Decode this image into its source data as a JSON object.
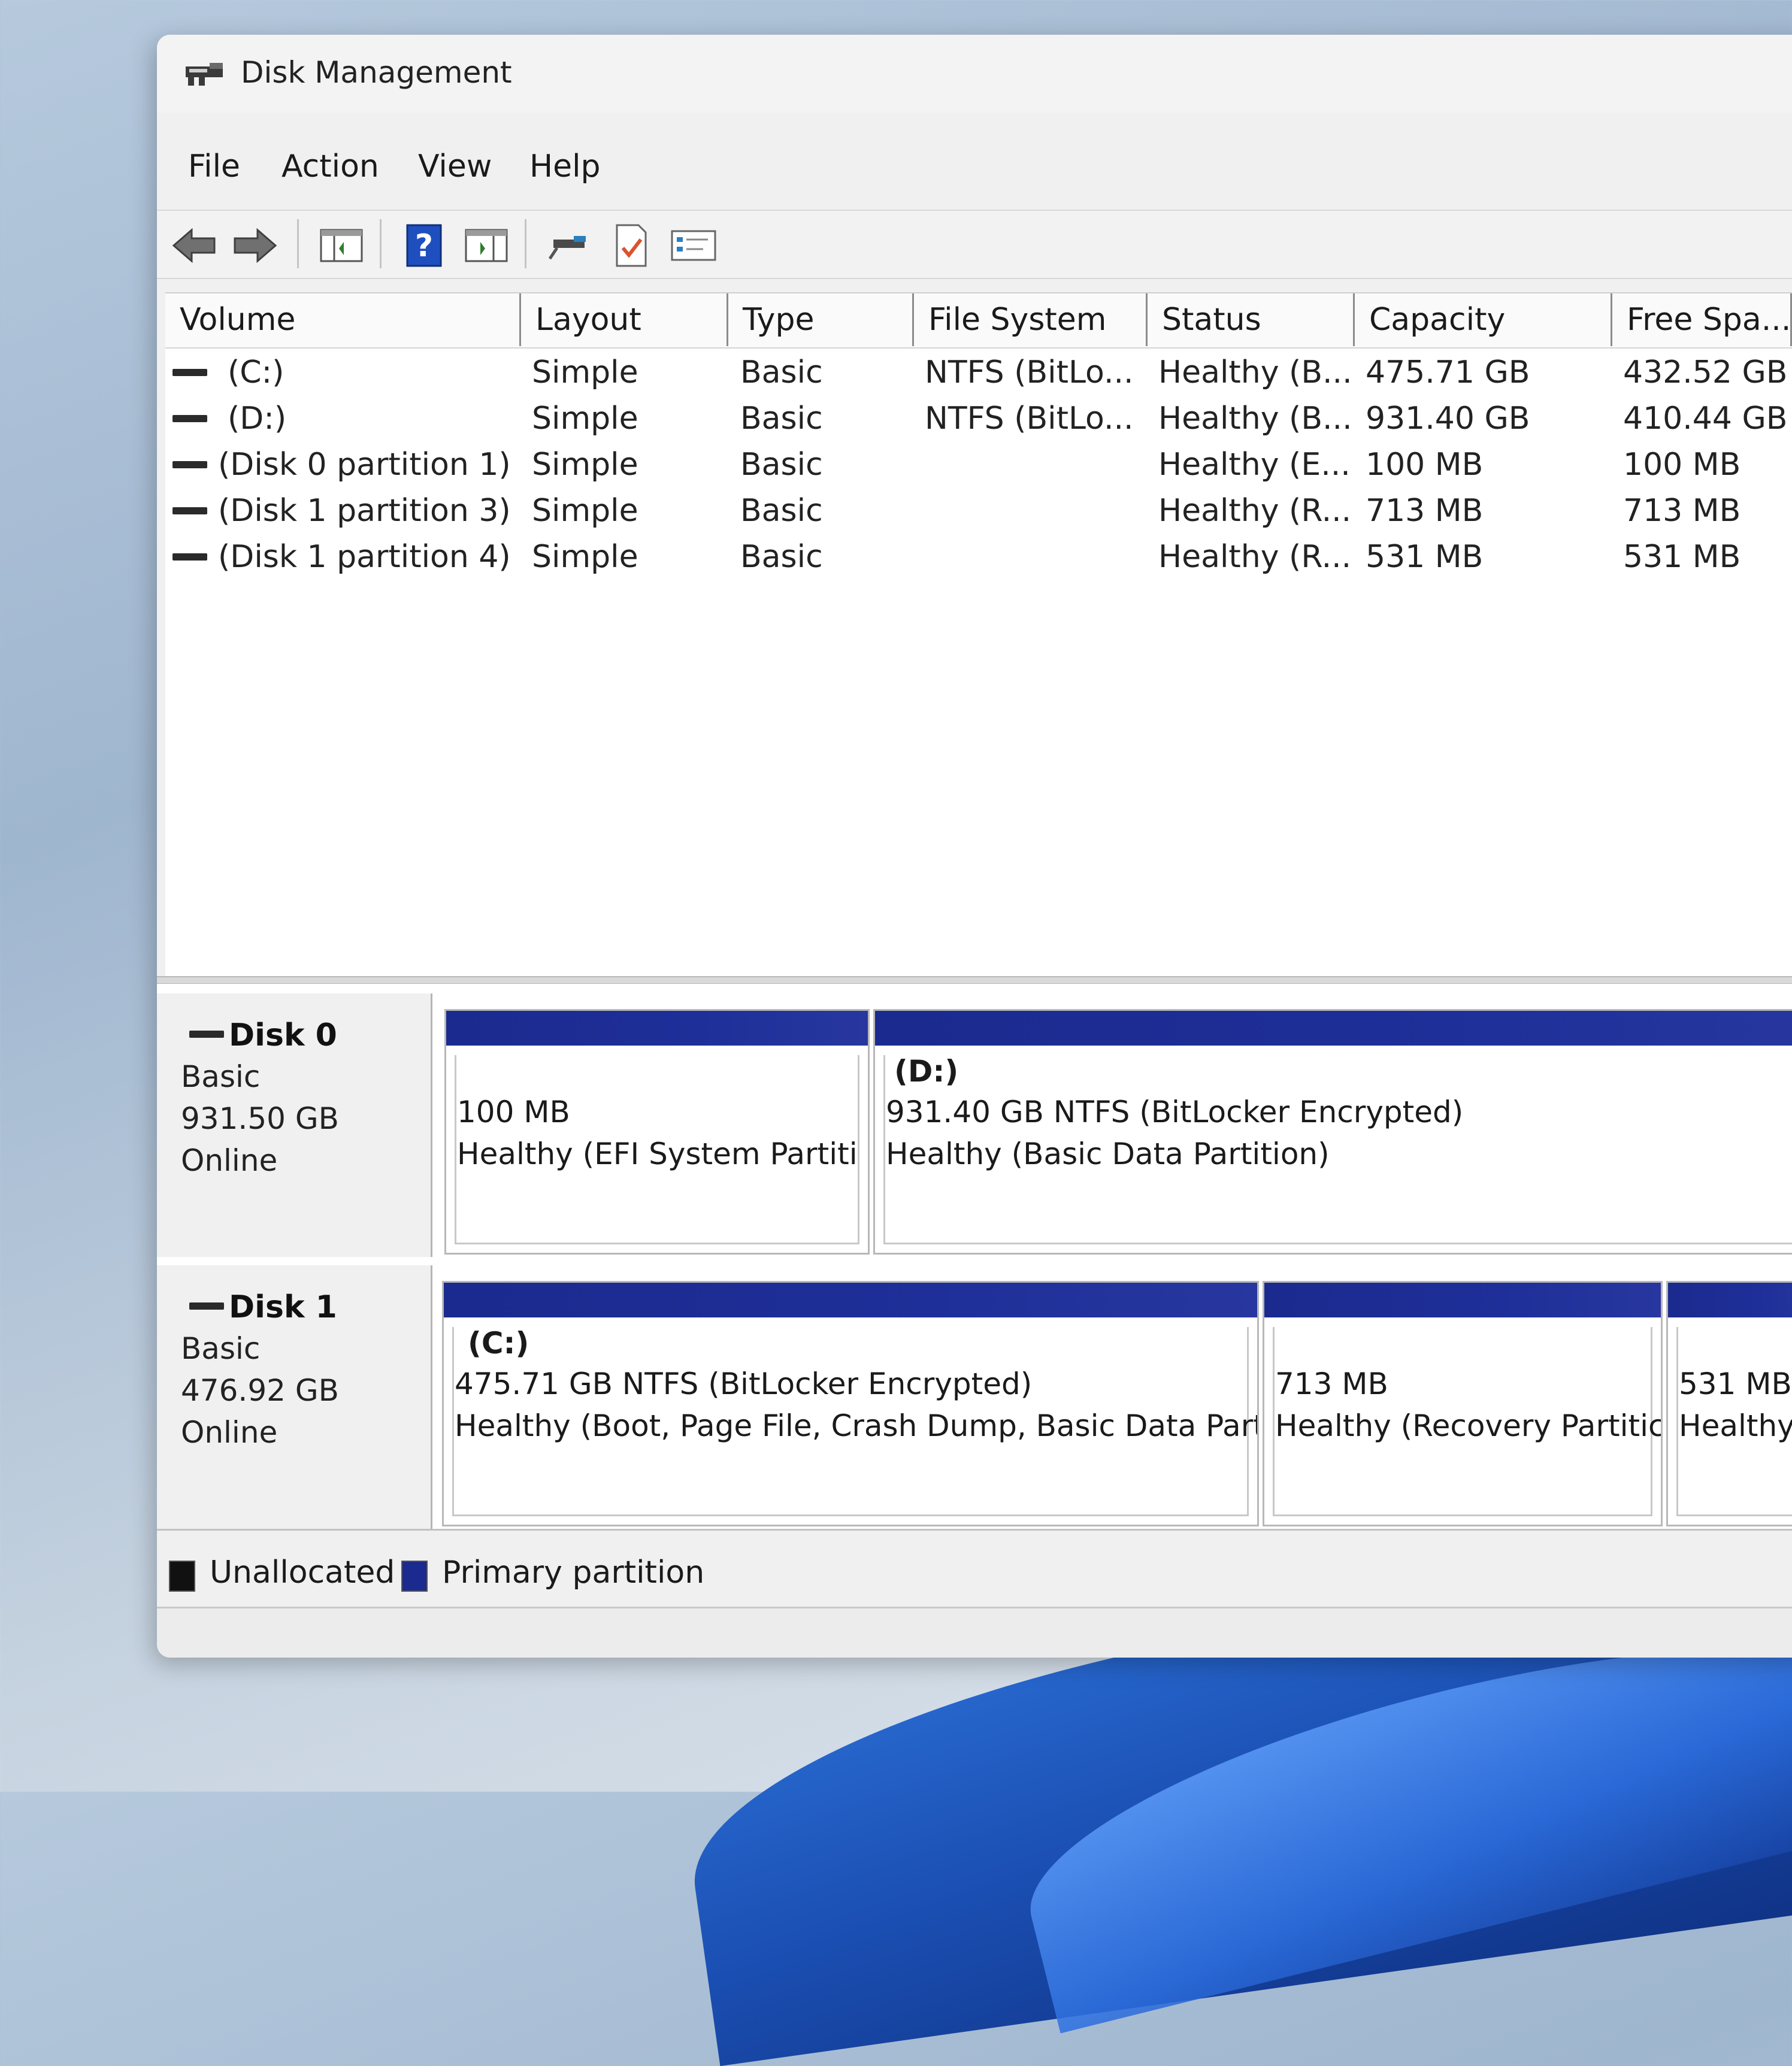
{
  "window": {
    "title": "Disk Management"
  },
  "menu": {
    "items": [
      "File",
      "Action",
      "View",
      "Help"
    ]
  },
  "toolbar": {
    "icons": [
      "back-arrow-icon",
      "forward-arrow-icon",
      "console-tree-icon",
      "help-icon",
      "properties-pane-icon",
      "connect-icon",
      "checklist-icon",
      "settings-list-icon"
    ]
  },
  "volume_table": {
    "columns": [
      "Volume",
      "Layout",
      "Type",
      "File System",
      "Status",
      "Capacity",
      "Free Spa..."
    ],
    "rows": [
      {
        "volume": "(C:)",
        "layout": "Simple",
        "type": "Basic",
        "fs": "NTFS (BitLo...",
        "status": "Healthy (B...",
        "capacity": "475.71 GB",
        "free": "432.52 GB"
      },
      {
        "volume": "(D:)",
        "layout": "Simple",
        "type": "Basic",
        "fs": "NTFS (BitLo...",
        "status": "Healthy (B...",
        "capacity": "931.40 GB",
        "free": "410.44 GB"
      },
      {
        "volume": "(Disk 0 partition 1)",
        "layout": "Simple",
        "type": "Basic",
        "fs": "",
        "status": "Healthy (E...",
        "capacity": "100 MB",
        "free": "100 MB"
      },
      {
        "volume": "(Disk 1 partition 3)",
        "layout": "Simple",
        "type": "Basic",
        "fs": "",
        "status": "Healthy (R...",
        "capacity": "713 MB",
        "free": "713 MB"
      },
      {
        "volume": "(Disk 1 partition 4)",
        "layout": "Simple",
        "type": "Basic",
        "fs": "",
        "status": "Healthy (R...",
        "capacity": "531 MB",
        "free": "531 MB"
      }
    ]
  },
  "disks": [
    {
      "name": "Disk 0",
      "kind": "Basic",
      "size": "931.50 GB",
      "state": "Online",
      "partitions": [
        {
          "title": "",
          "line1": "100 MB",
          "line2": "Healthy (EFI System Partiti"
        },
        {
          "title": "(D:)",
          "line1": "931.40 GB NTFS (BitLocker Encrypted)",
          "line2": "Healthy (Basic Data Partition)"
        }
      ]
    },
    {
      "name": "Disk 1",
      "kind": "Basic",
      "size": "476.92 GB",
      "state": "Online",
      "partitions": [
        {
          "title": "(C:)",
          "line1": "475.71 GB NTFS (BitLocker Encrypted)",
          "line2": "Healthy (Boot, Page File, Crash Dump, Basic Data Part"
        },
        {
          "title": "",
          "line1": "713 MB",
          "line2": "Healthy (Recovery Partitic"
        },
        {
          "title": "",
          "line1": "531 MB",
          "line2": "Healthy"
        }
      ]
    }
  ],
  "legend": {
    "unallocated": "Unallocated",
    "primary": "Primary partition",
    "unallocated_color": "#111111",
    "primary_color": "#1b2a8e"
  }
}
